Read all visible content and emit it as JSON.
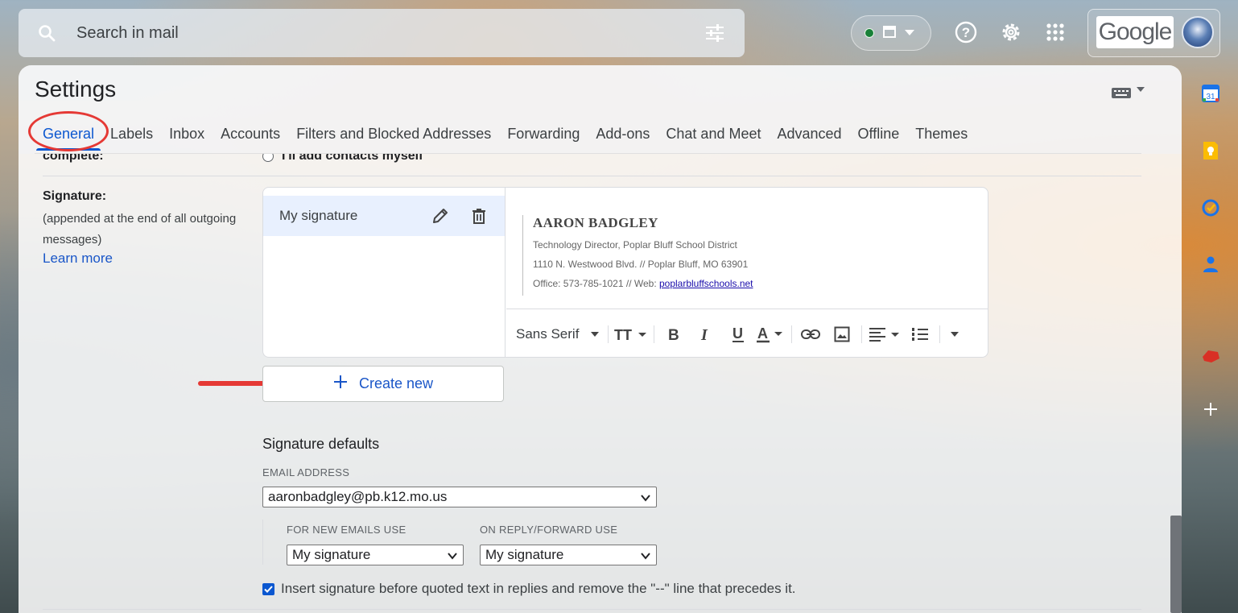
{
  "search": {
    "placeholder": "Search in mail"
  },
  "settings": {
    "title": "Settings"
  },
  "tabs": [
    {
      "label": "General"
    },
    {
      "label": "Labels"
    },
    {
      "label": "Inbox"
    },
    {
      "label": "Accounts"
    },
    {
      "label": "Filters and Blocked Addresses"
    },
    {
      "label": "Forwarding"
    },
    {
      "label": "Add-ons"
    },
    {
      "label": "Chat and Meet"
    },
    {
      "label": "Advanced"
    },
    {
      "label": "Offline"
    },
    {
      "label": "Themes"
    }
  ],
  "topbar": {
    "google_logo": "Google"
  },
  "general": {
    "complete_label": "complete:",
    "contacts_option": "I'll add contacts myself",
    "signature": {
      "label": "Signature:",
      "description": "(appended at the end of all outgoing messages)",
      "learn_more": "Learn more",
      "list_item": "My signature",
      "preview": {
        "name": "AARON BADGLEY",
        "line1": "Technology Director, Poplar Bluff School District",
        "line2": "1110 N. Westwood Blvd. // Poplar Bluff, MO  63901",
        "line3_prefix": "Office: 573-785-1021 // Web: ",
        "line3_link": "poplarbluffschools.net"
      },
      "toolbar": {
        "font": "Sans Serif"
      },
      "create_new": "Create new"
    },
    "defaults": {
      "title": "Signature defaults",
      "email_label": "EMAIL ADDRESS",
      "email_value": "aaronbadgley@pb.k12.mo.us",
      "new_label": "FOR NEW EMAILS USE",
      "new_value": "My signature",
      "reply_label": "ON REPLY/FORWARD USE",
      "reply_value": "My signature",
      "insert_before": "Insert signature before quoted text in replies and remove the \"--\" line that precedes it.",
      "insert_checked": true
    }
  },
  "colors": {
    "accent": "#0b57d0",
    "annotation": "#e53935",
    "link": "#1a56c8"
  }
}
